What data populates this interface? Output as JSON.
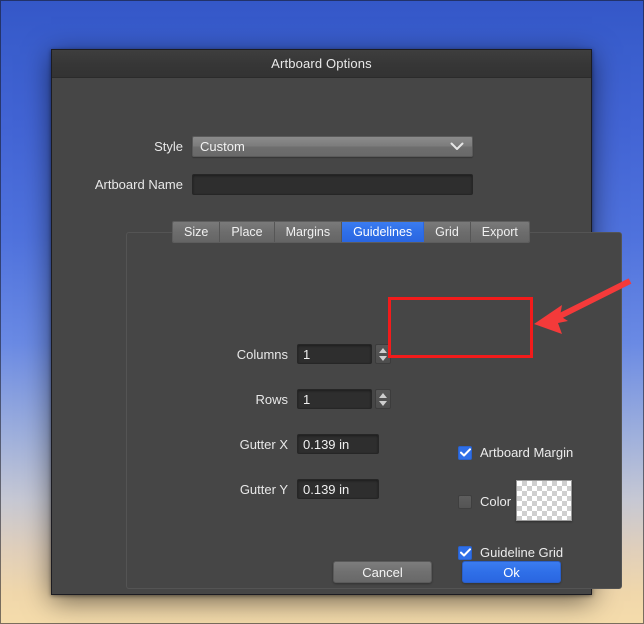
{
  "window": {
    "title": "Artboard Options"
  },
  "form": {
    "style": {
      "label": "Style",
      "value": "Custom",
      "icon": "chevron-down-icon"
    },
    "artboard_name": {
      "label": "Artboard Name",
      "value": "",
      "placeholder": ""
    }
  },
  "tabs": [
    {
      "label": "Size",
      "active": false
    },
    {
      "label": "Place",
      "active": false
    },
    {
      "label": "Margins",
      "active": false
    },
    {
      "label": "Guidelines",
      "active": true
    },
    {
      "label": "Grid",
      "active": false
    },
    {
      "label": "Export",
      "active": false
    }
  ],
  "guidelines": {
    "columns": {
      "label": "Columns",
      "value": "1"
    },
    "rows": {
      "label": "Rows",
      "value": "1"
    },
    "gutter_x": {
      "label": "Gutter X",
      "value": "0.139 in"
    },
    "gutter_y": {
      "label": "Gutter Y",
      "value": "0.139 in"
    },
    "artboard_margin": {
      "label": "Artboard Margin",
      "checked": true
    },
    "color": {
      "label": "Color",
      "checked": false,
      "swatch": "transparent-checkerboard"
    },
    "guideline_grid": {
      "label": "Guideline Grid",
      "checked": true
    }
  },
  "footer": {
    "cancel_label": "Cancel",
    "ok_label": "Ok"
  },
  "annotations": {
    "highlight_color": "#f21b1b",
    "arrow_color": "#f43a3a"
  },
  "colors": {
    "accent_blue": "#2f6fe8",
    "dialog_bg": "#464646",
    "titlebar_bg": "#383838",
    "input_bg": "#2e2e2e",
    "annotation_red": "#f21b1b"
  }
}
